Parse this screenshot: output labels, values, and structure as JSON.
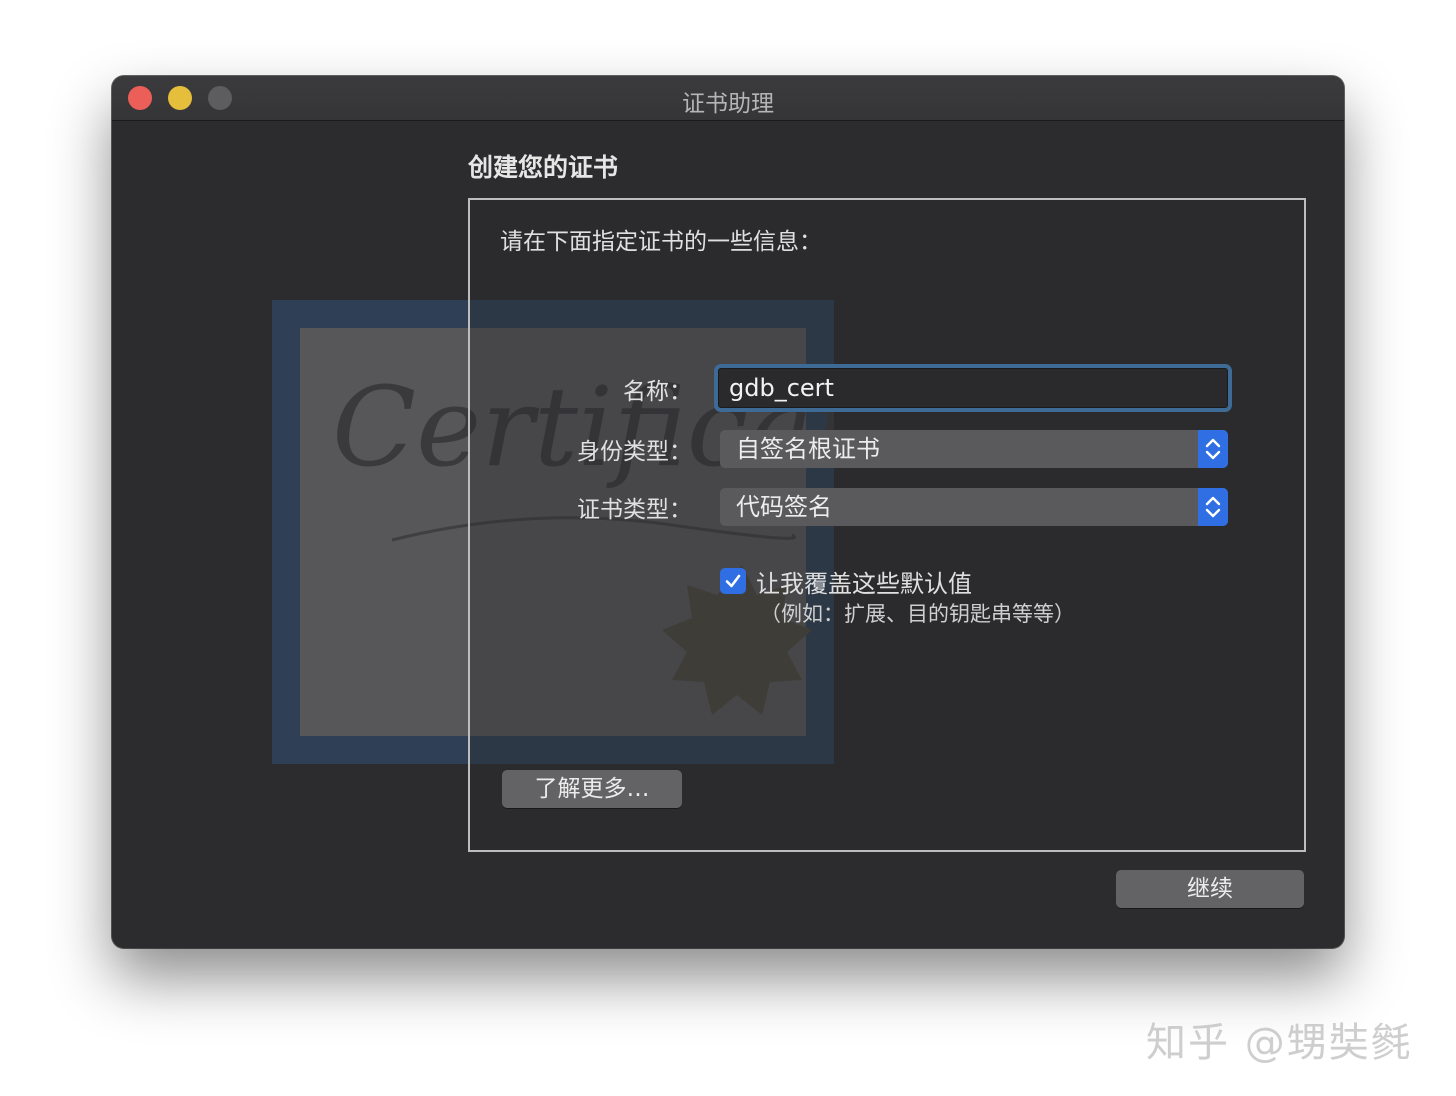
{
  "window": {
    "title": "证书助理"
  },
  "art": {
    "certificate_text": "Certificate"
  },
  "main": {
    "heading": "创建您的证书",
    "intro": "请在下面指定证书的一些信息：",
    "name_label": "名称：",
    "name_value": "gdb_cert",
    "identity_type_label": "身份类型：",
    "identity_type_value": "自签名根证书",
    "cert_type_label": "证书类型：",
    "cert_type_value": "代码签名",
    "override_checkbox": {
      "label": "让我覆盖这些默认值",
      "checked": true
    },
    "override_sublabel": "（例如：扩展、目的钥匙串等等）",
    "learn_more_label": "了解更多…"
  },
  "footer": {
    "continue_label": "继续"
  },
  "watermark": "知乎 @甥奘毿",
  "colors": {
    "accent": "#2f6fe3",
    "focus_ring": "#3d6b95",
    "window_bg": "#2c2c2e"
  }
}
